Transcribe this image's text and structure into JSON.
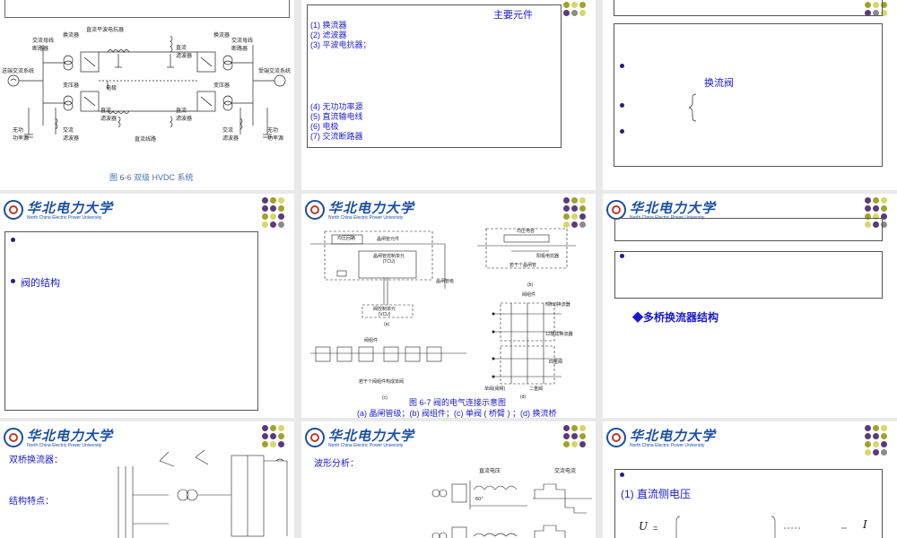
{
  "brand": {
    "logo_cn": "华北电力大学",
    "logo_en": "North China Electric Power University"
  },
  "dot_colors": [
    "#5c3a7a",
    "#9fa32a",
    "#d6d66a",
    "#8a8a8a"
  ],
  "slide1": {
    "caption": "图 6-6   双级 HVDC 系统",
    "labels": {
      "send_ac": "送端交流系统",
      "recv_ac": "受端交流系统",
      "ac_bus_breaker": "交流母线\n断路器",
      "converter": "换流器",
      "transformer": "变压器",
      "dc_reactor": "直流平波电抗器",
      "dc_filter": "直流\n滤波器",
      "electrode": "电极",
      "dc_line": "直流线路",
      "ac_filter": "交流\n滤波器",
      "reactive_power_source": "无功\n功率源"
    }
  },
  "slide2": {
    "title": "主要元件",
    "items": [
      "(1) 换流器",
      "(2) 滤波器",
      "(3) 平波电抗器；",
      "(4) 无功功率源",
      "(5) 直流输电线",
      "(6) 电极",
      "(7) 交流断路器"
    ]
  },
  "slide3": {
    "label": "换流阀"
  },
  "slide4": {
    "label": "阀的结构"
  },
  "slide5": {
    "caption_title": "图 6-7   阀的电气连接示意图",
    "caption_sub": "(a) 晶闸管级；(b) 阀组件；(c) 单阀 ( 桥臂 ) ；(d) 换流桥",
    "diagram_labels": {
      "snubber": "均压回路",
      "thyristor_element": "晶闸管元件",
      "tcu": "晶闸管控制单元\n(TCU)",
      "thyristor_level": "晶闸管级",
      "vcu": "阀控制单元\n(VCU)",
      "grading_cap": "均压电容",
      "anode_reactor": "阳极电抗器",
      "several_thyristor_levels": "若干个晶闸管",
      "valve_module": "阀组件",
      "several_modules": "若干个阀组件构成单阀",
      "six_pulse": "6脉动换流器",
      "twelve_pulse": "12脉动换流器",
      "quad_valve": "四重阀",
      "single_valve": "单阀(阀臂)",
      "double_valve": "二重阀",
      "a": "(a)",
      "b": "(b)",
      "c": "(c)",
      "d": "(d)"
    }
  },
  "slide6": {
    "title": "◆多桥换流器结构"
  },
  "slide7": {
    "title": "双桥换流器：",
    "subtitle": "结构特点："
  },
  "slide8": {
    "title": "波形分析：",
    "dc_voltage": "直流电压",
    "ac_current": "交流电流"
  },
  "slide9": {
    "title": "(1) 直流侧电压",
    "formula_lhs": "U",
    "formula_sub": "=",
    "formula_rhs": "I"
  }
}
